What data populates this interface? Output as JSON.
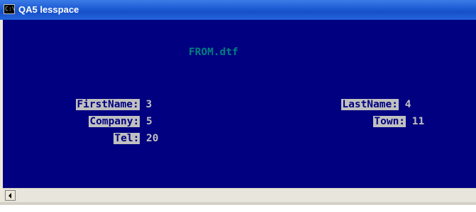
{
  "window": {
    "title": "QA5 lesspace",
    "icon_glyph": "C:\\"
  },
  "console": {
    "heading": "FROM.dtf",
    "fields": [
      {
        "label": "FirstName:",
        "value": "3"
      },
      {
        "label": "Company:",
        "value": "5"
      },
      {
        "label": "Tel:",
        "value": "20"
      },
      {
        "label": "LastName:",
        "value": "4"
      },
      {
        "label": "Town:",
        "value": "11"
      }
    ]
  },
  "colors": {
    "console_background": "#000080",
    "label_background": "#c0c0c0",
    "label_text": "#000080",
    "value_text": "#c0c0c0",
    "heading_text": "#008080"
  },
  "icons": {
    "title_icon": "console-icon",
    "scroll_left": "scroll-left-arrow-icon"
  }
}
